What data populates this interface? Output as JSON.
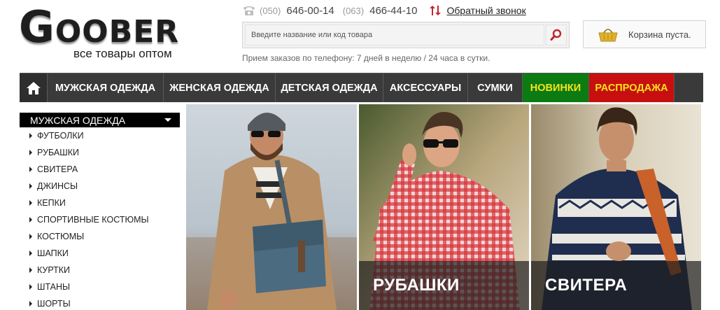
{
  "brand": {
    "logo_text": "GOOBER",
    "tagline": "все товары оптом"
  },
  "header": {
    "phones": [
      {
        "code": "(050)",
        "number": "646-00-14"
      },
      {
        "code": "(063)",
        "number": "466-44-10"
      }
    ],
    "callback_label": "Обратный звонок",
    "search_placeholder": "Введите название или код товара",
    "hours_text": "Прием заказов по телефону: 7 дней в неделю / 24 часа в сутки.",
    "cart_text": "Корзина пуста."
  },
  "nav": {
    "items": [
      {
        "label": "МУЖСКАЯ ОДЕЖДА"
      },
      {
        "label": "ЖЕНСКАЯ ОДЕЖДА"
      },
      {
        "label": "ДЕТСКАЯ ОДЕЖДА"
      },
      {
        "label": "АКСЕССУАРЫ"
      },
      {
        "label": "СУМКИ"
      },
      {
        "label": "НОВИНКИ"
      },
      {
        "label": "РАСПРОДАЖА"
      }
    ]
  },
  "sidebar": {
    "title": "МУЖСКАЯ ОДЕЖДА",
    "items": [
      {
        "label": "ФУТБОЛКИ"
      },
      {
        "label": "РУБАШКИ"
      },
      {
        "label": "СВИТЕРА"
      },
      {
        "label": "ДЖИНСЫ"
      },
      {
        "label": "КЕПКИ"
      },
      {
        "label": "СПОРТИВНЫЕ КОСТЮМЫ"
      },
      {
        "label": "КОСТЮМЫ"
      },
      {
        "label": "ШАПКИ"
      },
      {
        "label": "КУРТКИ"
      },
      {
        "label": "ШТАНЫ"
      },
      {
        "label": "ШОРТЫ"
      }
    ]
  },
  "tiles": [
    {
      "label": ""
    },
    {
      "label": "РУБАШКИ"
    },
    {
      "label": "СВИТЕРА"
    }
  ],
  "colors": {
    "nav_bg": "#3a3a3a",
    "new_bg": "#0b7b12",
    "sale_bg": "#c70f0f",
    "highlight_text": "#f7e31a",
    "search_accent": "#c0262d"
  },
  "icons": [
    "phone-icon",
    "swap-arrows-icon",
    "search-icon",
    "basket-icon",
    "home-icon",
    "chevron-down-icon"
  ]
}
